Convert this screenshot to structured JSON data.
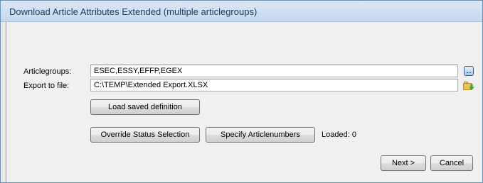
{
  "window": {
    "title": "Download Article Attributes Extended (multiple articlegroups)"
  },
  "form": {
    "articlegroups_label": "Articlegroups:",
    "articlegroups_value": "ESEC,ESSY,EFFP,EGEX",
    "articlegroups_browse_icon": "browse-icon",
    "export_label": "Export to file:",
    "export_value": "C:\\TEMP\\Extended Export.XLSX",
    "export_folder_icon": "folder-icon",
    "load_button": "Load saved definition",
    "override_button": "Override Status Selection",
    "specify_button": "Specify Articlenumbers",
    "loaded_text": "Loaded: 0"
  },
  "footer": {
    "next_label": "Next >",
    "cancel_label": "Cancel"
  }
}
